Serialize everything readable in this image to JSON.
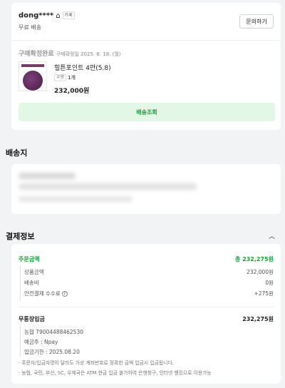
{
  "order": {
    "seller": "dong****",
    "seller_badge": "카페",
    "shipping_type": "무료 배송",
    "inquiry_button": "문의하기",
    "status": "구매확정완료",
    "status_date": "구매확정일 2025. 8. 18. (월)",
    "product_name": "힐튼포인트 4만(5.8)",
    "qty_label": "수량",
    "qty_value": "1개",
    "price": "232,000원",
    "track_button": "배송조회"
  },
  "address": {
    "title": "배송지"
  },
  "payment": {
    "title": "결제정보",
    "order_amount_label": "주문금액",
    "order_amount_total": "총 232,275원",
    "product_amount_label": "상품금액",
    "product_amount": "232,000원",
    "shipping_fee_label": "배송비",
    "shipping_fee": "0원",
    "safe_fee_label": "안전결제 수수료",
    "safe_fee": "+275원",
    "bank_label": "무통장입금",
    "bank_amount": "232,275원",
    "bank_account": "농협 79004488462530",
    "depositor": "예금주 : Npay",
    "deadline": "입금기한 : 2025.08.20",
    "note1": "· 주문자/입금자명이 달라도 가상 계좌번호로 정확한 금액 입금시 입금됩니다.",
    "note2": "· 농협, 국민, 부산, SC, 우체국은 ATM 현금 입금 불가하여 은행창구, 인터넷 뱅킹으로 이용가능"
  },
  "colors": {
    "accent_green": "#13a33b",
    "green_bg": "#e3f7e6"
  },
  "icons": {
    "home": "home-icon",
    "help": "help-circle-icon",
    "collapse": "chevron-up-icon"
  }
}
